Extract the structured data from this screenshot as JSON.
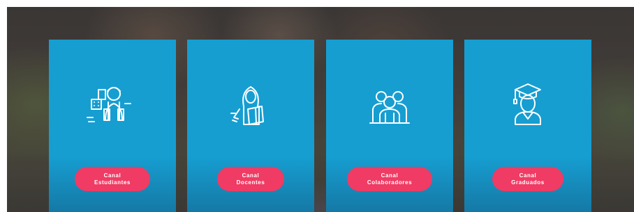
{
  "cards": [
    {
      "icon": "student-icon",
      "button": {
        "line1": "Canal",
        "line2": "Estudiantes"
      }
    },
    {
      "icon": "teacher-icon",
      "button": {
        "line1": "Canal",
        "line2": "Docentes"
      }
    },
    {
      "icon": "collaborators-icon",
      "button": {
        "line1": "Canal",
        "line2": "Colaboradores"
      }
    },
    {
      "icon": "graduate-icon",
      "button": {
        "line1": "Canal",
        "line2": "Graduados"
      }
    }
  ],
  "colors": {
    "card": "#169ed1",
    "button": "#f03b64",
    "icon_stroke": "#ffffff"
  }
}
